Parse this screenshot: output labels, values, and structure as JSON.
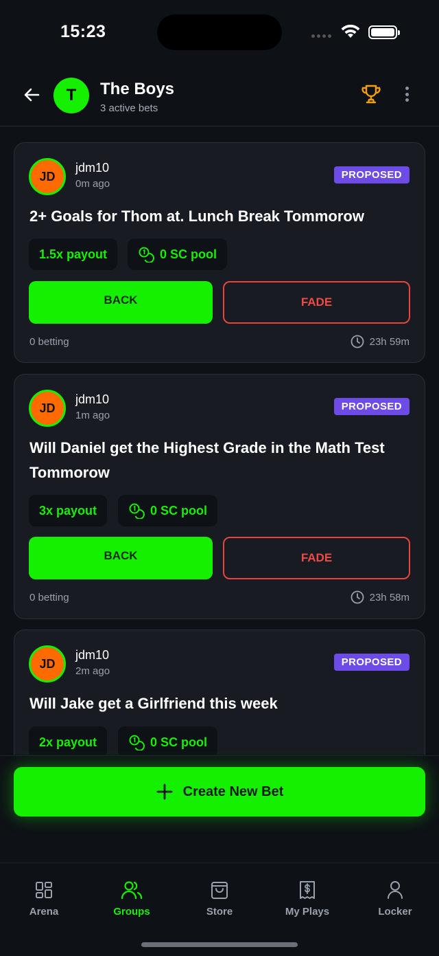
{
  "status_bar": {
    "time": "15:23"
  },
  "header": {
    "group_initial": "T",
    "group_name": "The Boys",
    "subtitle": "3 active bets"
  },
  "bets": [
    {
      "user_initials": "JD",
      "username": "jdm10",
      "time_ago": "0m ago",
      "status": "PROPOSED",
      "title": "2+ Goals for Thom at. Lunch Break Tommorow",
      "payout": "1.5x payout",
      "pool": "0 SC pool",
      "back_label": "BACK",
      "fade_label": "FADE",
      "betting": "0 betting",
      "remaining": "23h 59m"
    },
    {
      "user_initials": "JD",
      "username": "jdm10",
      "time_ago": "1m ago",
      "status": "PROPOSED",
      "title": "Will Daniel get the Highest Grade in the Math Test Tommorow",
      "payout": "3x payout",
      "pool": "0 SC pool",
      "back_label": "BACK",
      "fade_label": "FADE",
      "betting": "0 betting",
      "remaining": "23h 58m"
    },
    {
      "user_initials": "JD",
      "username": "jdm10",
      "time_ago": "2m ago",
      "status": "PROPOSED",
      "title": "Will Jake get a Girlfriend this week",
      "payout": "2x payout",
      "pool": "0 SC pool"
    }
  ],
  "create_button": {
    "label": "Create New Bet"
  },
  "tabs": [
    {
      "label": "Arena",
      "icon": "grid-icon"
    },
    {
      "label": "Groups",
      "icon": "users-icon"
    },
    {
      "label": "Store",
      "icon": "bag-icon"
    },
    {
      "label": "My Plays",
      "icon": "receipt-icon"
    },
    {
      "label": "Locker",
      "icon": "user-icon"
    }
  ],
  "colors": {
    "accent": "#14f000",
    "fade": "#ef4a43",
    "badge": "#6d4be6",
    "avatar": "#ff6b00",
    "trophy": "#f59e0b"
  }
}
